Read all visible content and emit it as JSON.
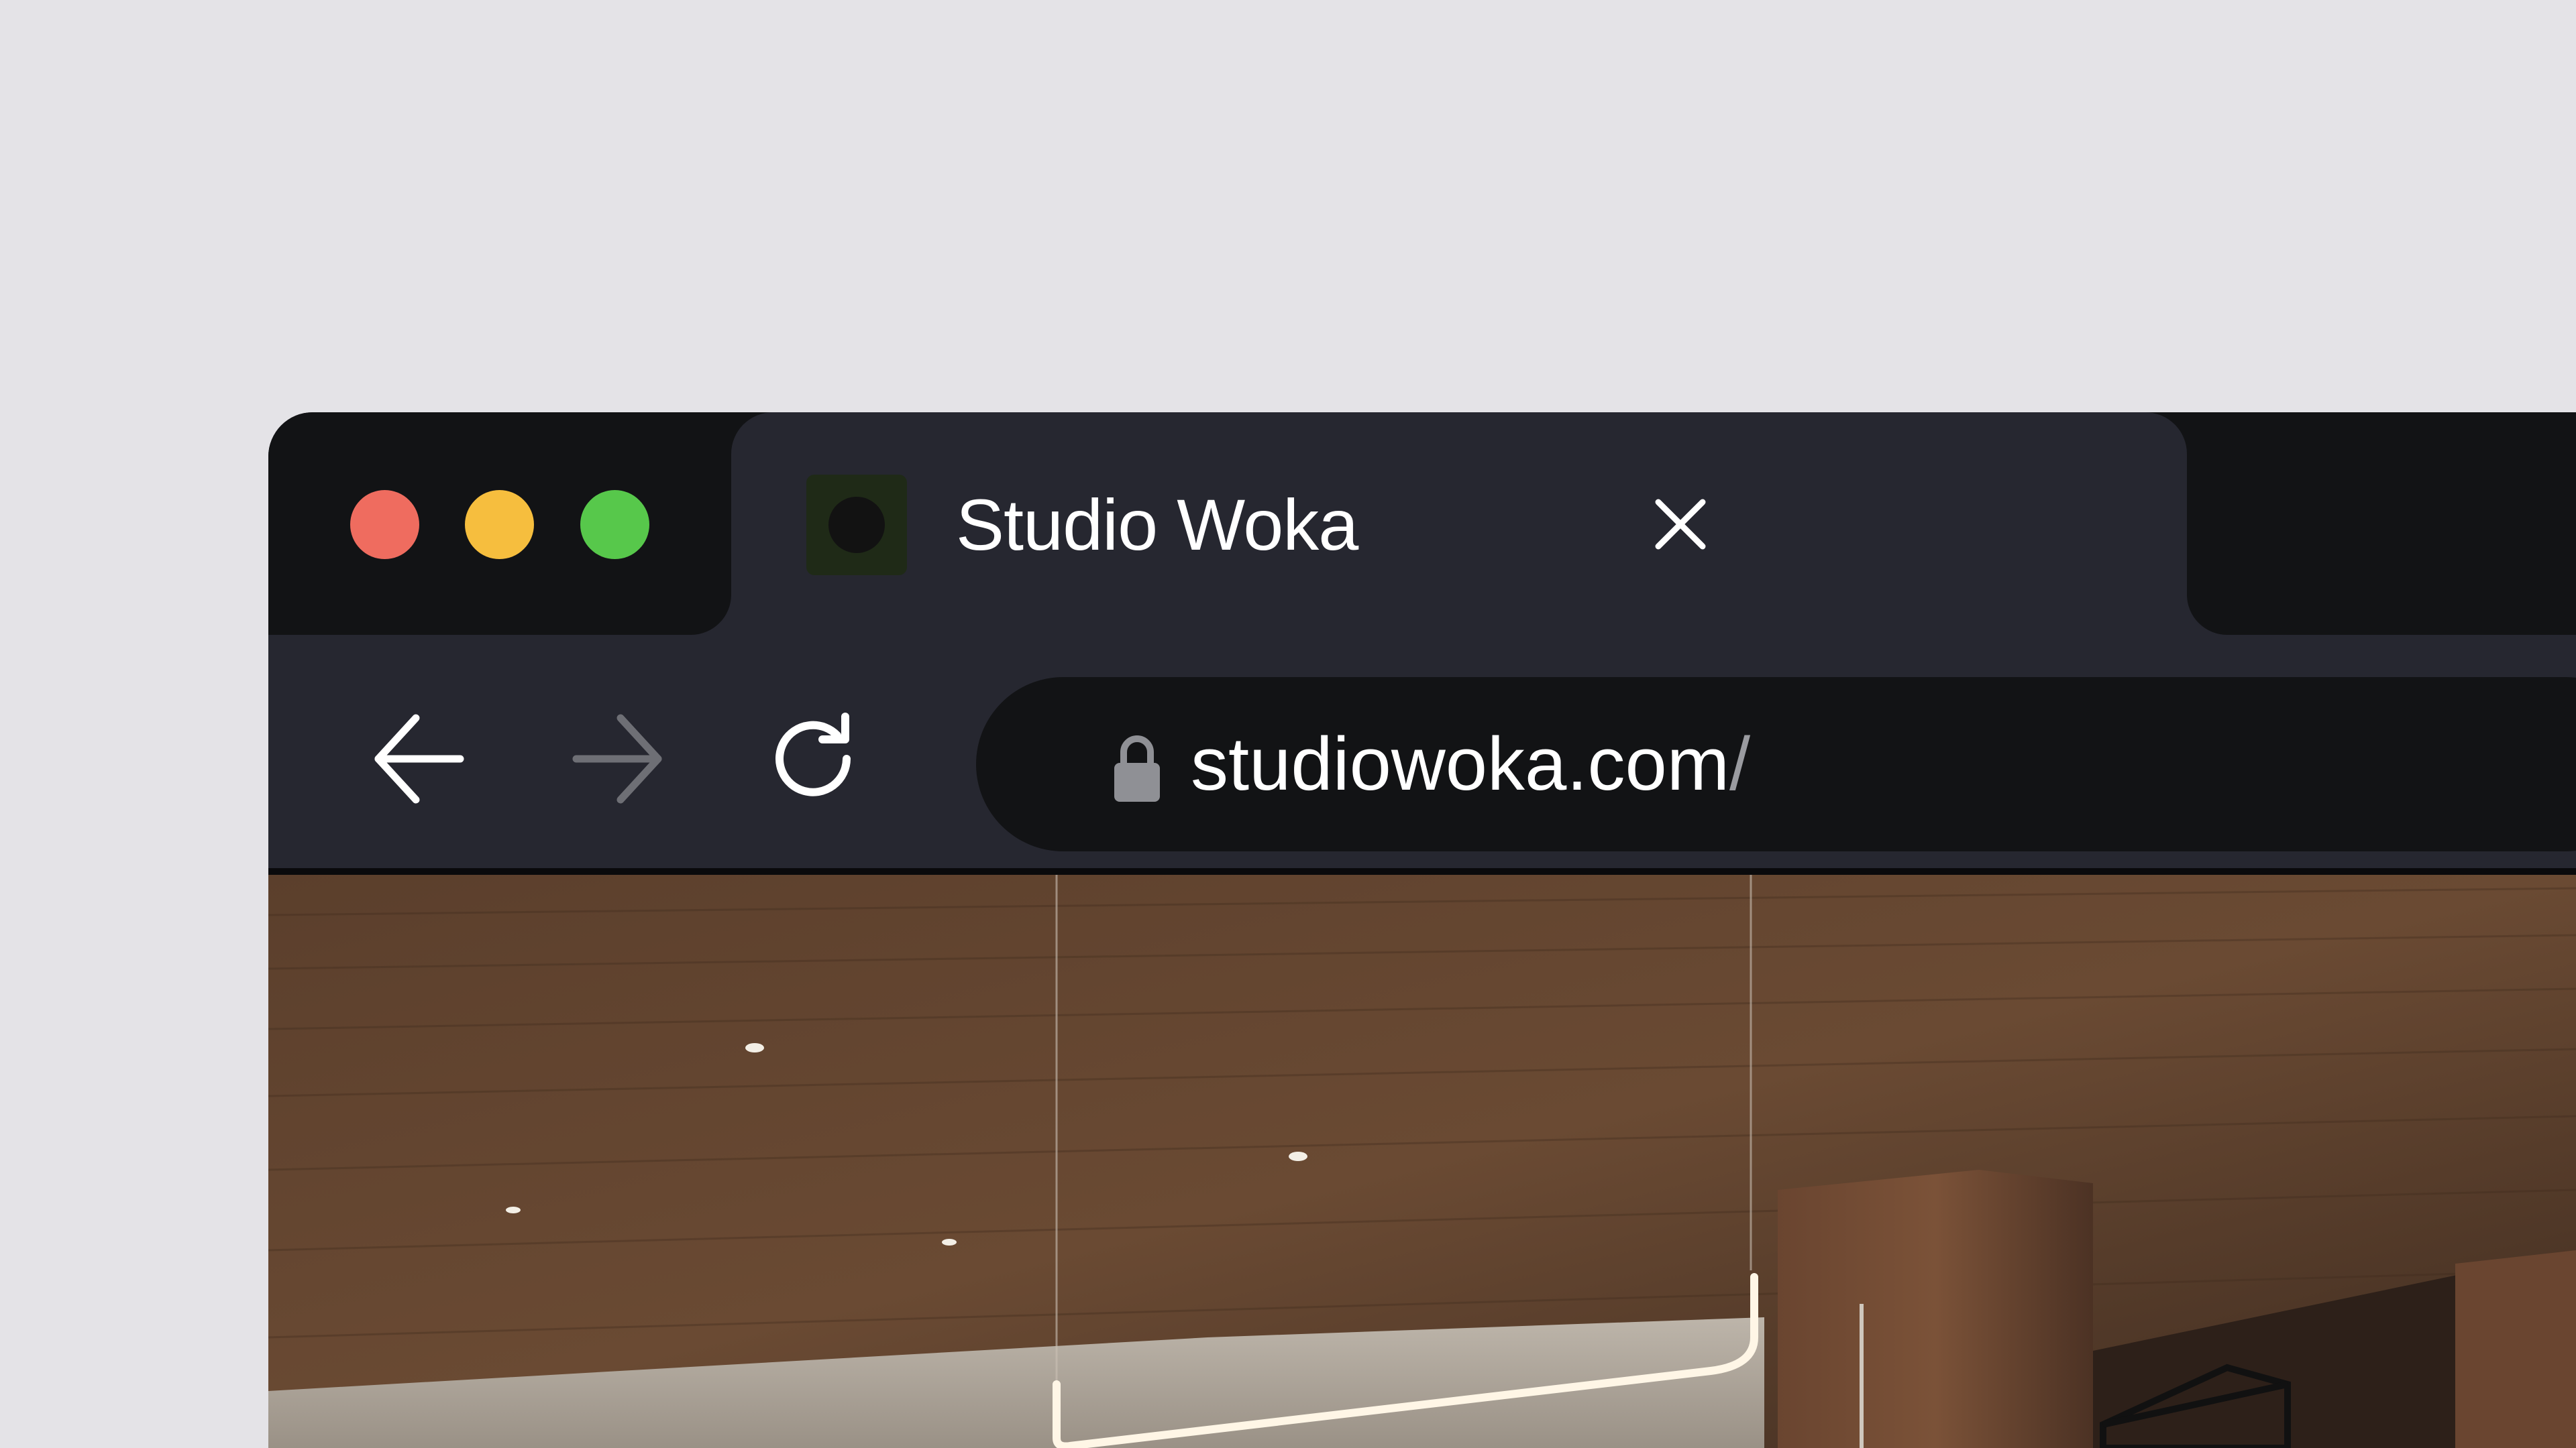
{
  "window": {
    "traffic_lights": {
      "close_color": "#ef6c5f",
      "minimize_color": "#f6be3e",
      "maximize_color": "#57c84b"
    }
  },
  "tab": {
    "title": "Studio Woka",
    "favicon": "studio-woka-logo-icon",
    "close_icon": "close-icon"
  },
  "toolbar": {
    "back_icon": "arrow-left-icon",
    "forward_icon": "arrow-right-icon",
    "reload_icon": "reload-icon",
    "address": {
      "lock_icon": "lock-icon",
      "url": "studiowoka.com",
      "url_suffix": "/"
    }
  },
  "page": {
    "hero_image": "interior with wooden ceiling, pendant light and wooden column"
  },
  "colors": {
    "background": "#e4e3e7",
    "titlebar": "#121315",
    "tab": "#262730",
    "urlbar": "#121315"
  }
}
